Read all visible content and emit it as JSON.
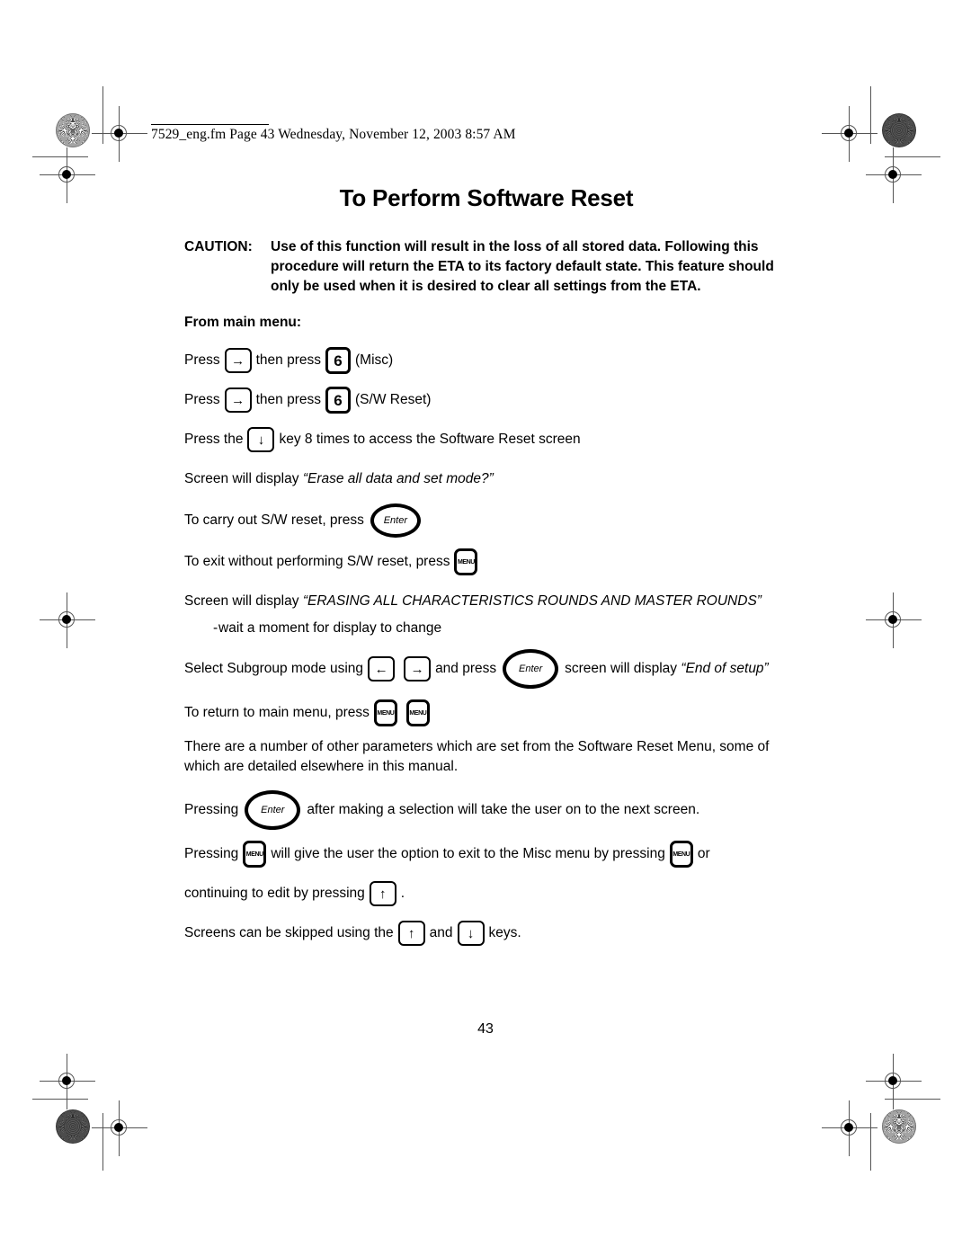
{
  "header": {
    "file_line": "7529_eng.fm  Page 43  Wednesday, November 12, 2003  8:57 AM"
  },
  "document": {
    "title": "To Perform Software Reset",
    "page_number": "43"
  },
  "caution": {
    "label": "CAUTION:",
    "body": "Use of this function will result in the loss of all stored data. Following this procedure will return the ETA to its factory default state. This feature should only be used when it is desired to clear all settings from the ETA."
  },
  "section": {
    "subhead": "From main menu:"
  },
  "keys": {
    "right_arrow": "→",
    "left_arrow": "←",
    "down_arrow": "↓",
    "up_arrow": "↑",
    "six": "6",
    "menu": "MENU",
    "enter": "Enter"
  },
  "steps": {
    "s1_press": "Press",
    "s1_then": "then press",
    "s1_note": "(Misc)",
    "s2_press": "Press",
    "s2_then": "then press",
    "s2_note": "(S/W Reset)",
    "s3_pre": "Press the",
    "s3_post": "key 8 times to access the Software Reset screen",
    "s4_pre": "Screen will display ",
    "s4_quote": "“Erase all data and set mode?”",
    "s5_pre": "To carry out S/W reset, press",
    "s6_pre": "To exit without performing S/W reset, press",
    "s7_pre": "Screen will display ",
    "s7_quote": "“ERASING ALL CHARACTERISTICS ROUNDS AND MASTER ROUNDS”",
    "s8_dash": "-",
    "s8_text": "wait a moment for display to change",
    "s9_pre": "Select Subgroup mode using",
    "s9_mid": "and press",
    "s9_post": "screen will display ",
    "s9_quote": "“End of setup”",
    "s10_pre": "To return to main menu, press"
  },
  "notes": {
    "p1": "There are a number of other parameters which are set from the Software Reset Menu, some of which are detailed elsewhere in this manual.",
    "p2_pre": "Pressing",
    "p2_post": "after making a selection will take the user on to the next screen.",
    "p3_pre": "Pressing",
    "p3_mid": "will give the user the option to exit to the Misc menu by pressing",
    "p3_post": "or",
    "p4_pre": "continuing to edit by pressing",
    "p4_post": ".",
    "p5_pre": "Screens can be skipped using the",
    "p5_mid": "and",
    "p5_post": "keys."
  }
}
